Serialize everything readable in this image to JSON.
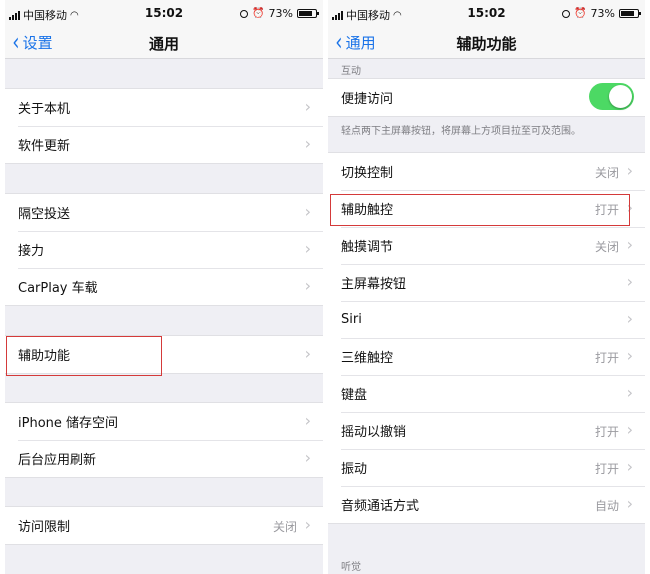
{
  "status_bar": {
    "carrier": "中国移动",
    "time": "15:02",
    "battery": "73%"
  },
  "left_screen": {
    "nav": {
      "back_label": "设置",
      "title": "通用"
    },
    "groups": [
      {
        "items": [
          {
            "label": "关于本机"
          },
          {
            "label": "软件更新"
          }
        ]
      },
      {
        "items": [
          {
            "label": "隔空投送"
          },
          {
            "label": "接力"
          },
          {
            "label": "CarPlay 车载"
          }
        ]
      },
      {
        "items": [
          {
            "label": "辅助功能",
            "highlighted": true
          }
        ]
      },
      {
        "items": [
          {
            "label": "iPhone 储存空间"
          },
          {
            "label": "后台应用刷新"
          }
        ]
      },
      {
        "items": [
          {
            "label": "访问限制",
            "value": "关闭"
          }
        ]
      }
    ]
  },
  "right_screen": {
    "nav": {
      "back_label": "通用",
      "title": "辅助功能"
    },
    "section_interaction": "互动",
    "reachability": {
      "label": "便捷访问",
      "on": true,
      "footer": "轻点两下主屏幕按钮，将屏幕上方项目拉至可及范围。"
    },
    "items": [
      {
        "label": "切换控制",
        "value": "关闭"
      },
      {
        "label": "辅助触控",
        "value": "打开",
        "highlighted": true
      },
      {
        "label": "触摸调节",
        "value": "关闭"
      },
      {
        "label": "主屏幕按钮",
        "value": ""
      },
      {
        "label": "Siri",
        "value": ""
      },
      {
        "label": "三维触控",
        "value": "打开"
      },
      {
        "label": "键盘",
        "value": ""
      },
      {
        "label": "摇动以撤销",
        "value": "打开"
      },
      {
        "label": "振动",
        "value": "打开"
      },
      {
        "label": "音频通话方式",
        "value": "自动"
      }
    ],
    "section_hearing": "听觉"
  },
  "colors": {
    "accent": "#1a73e8",
    "toggle_on": "#4cd964",
    "highlight": "#d43a3a"
  },
  "icons": {
    "chevron": "›",
    "back": "‹",
    "wifi": "wifi-icon",
    "lock": "rotation-lock-icon",
    "alarm": "alarm-icon"
  }
}
